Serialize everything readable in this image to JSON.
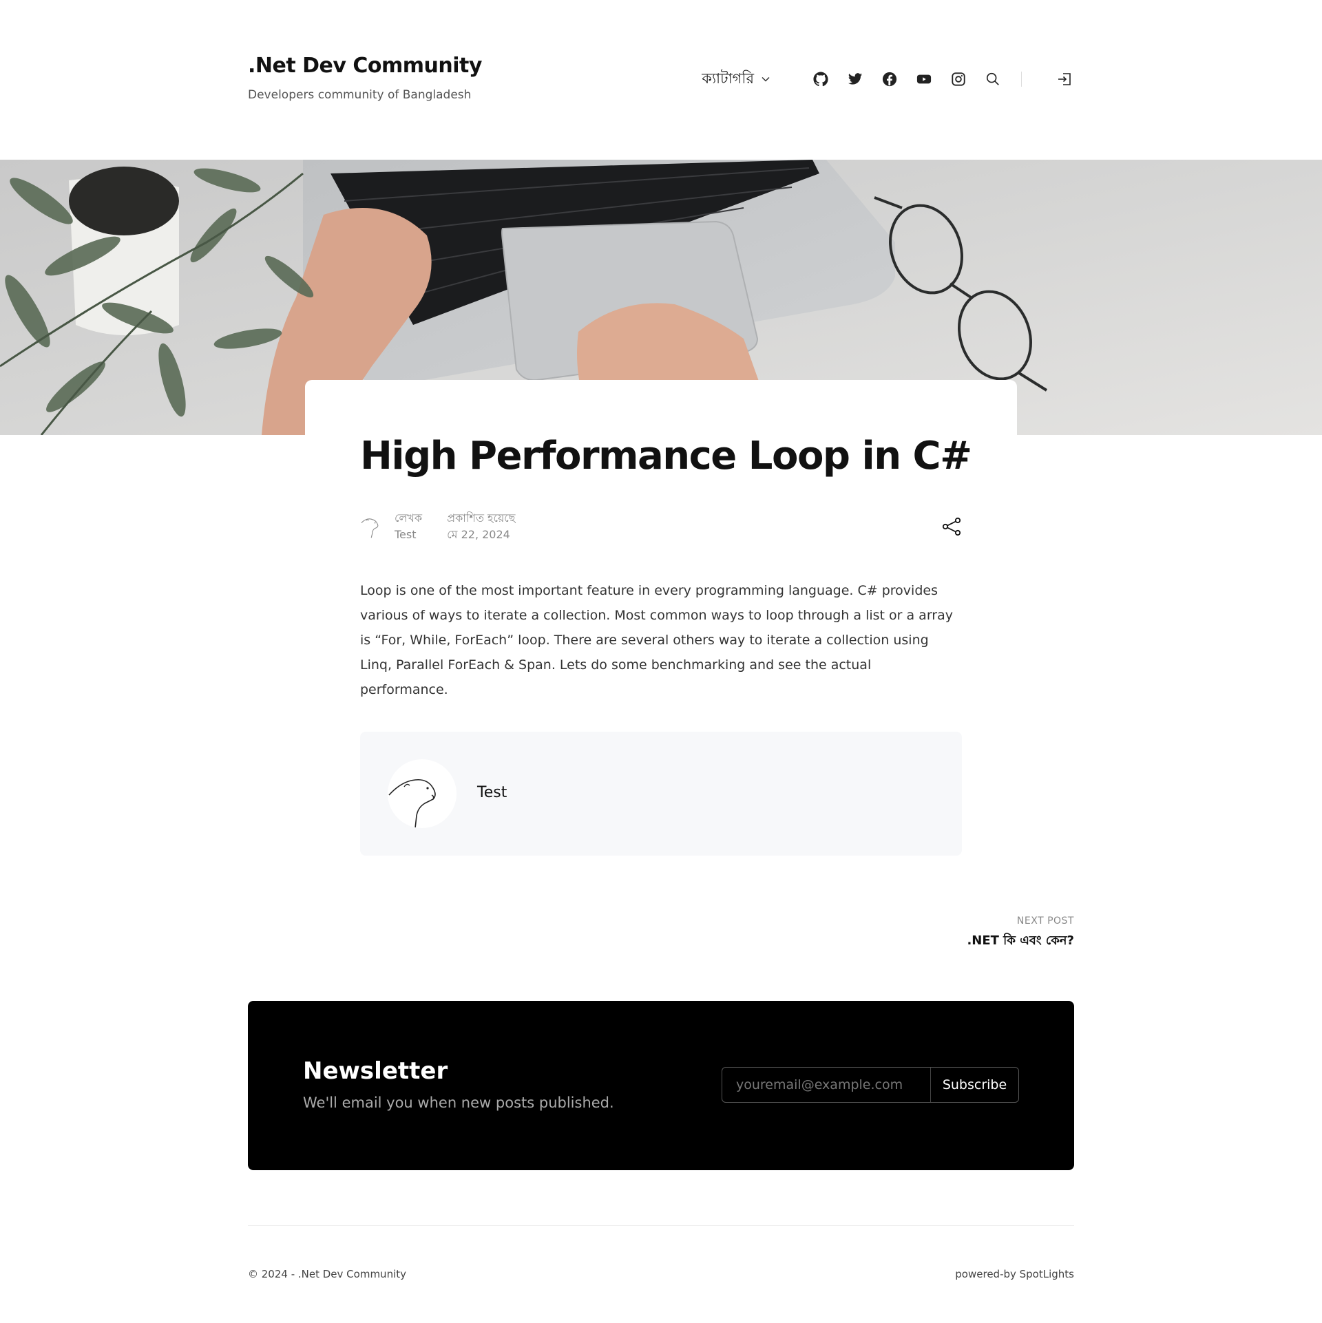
{
  "site": {
    "title": ".Net Dev Community",
    "tagline": "Developers community of Bangladesh"
  },
  "nav": {
    "category_label": "ক্যাটাগরি",
    "icons": [
      "chevron-down-icon",
      "github-icon",
      "twitter-icon",
      "facebook-icon",
      "youtube-icon",
      "instagram-icon",
      "search-icon",
      "sign-in-icon"
    ]
  },
  "post": {
    "title": "High Performance Loop in C#",
    "author_label": "লেখক",
    "author_name": "Test",
    "published_label": "প্রকাশিত হয়েছে",
    "published_date": "মে 22, 2024",
    "body": "Loop is one of the most important feature in every programming language. C# provides various of ways to iterate a collection. Most common ways to loop through a list or a array is “For, While, ForEach” loop. There are several others way to iterate a collection using Linq, Parallel ForEach & Span. Lets do some benchmarking and see the actual performance."
  },
  "author_box": {
    "name": "Test"
  },
  "next_post": {
    "label": "NEXT POST",
    "title": ".NET কি এবং কেন?"
  },
  "newsletter": {
    "title": "Newsletter",
    "subtitle": "We'll email you when new posts published.",
    "placeholder": "youremail@example.com",
    "button": "Subscribe"
  },
  "footer": {
    "copyright": "© 2024 - .Net Dev Community",
    "powered": "powered-by SpotLights"
  }
}
